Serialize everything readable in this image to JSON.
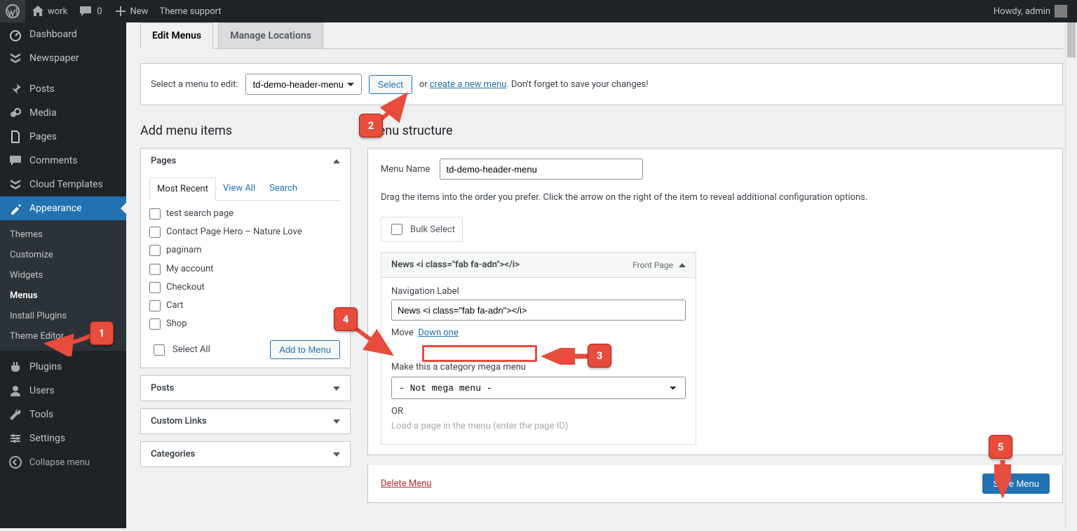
{
  "adminbar": {
    "site_name": "work",
    "comments_count": "0",
    "new_label": "New",
    "theme_support": "Theme support",
    "howdy": "Howdy, admin"
  },
  "sidebar": {
    "items": [
      {
        "label": "Dashboard",
        "icon": "dashboard"
      },
      {
        "label": "Newspaper",
        "icon": "newspaper"
      },
      {
        "label": "Posts",
        "icon": "pin"
      },
      {
        "label": "Media",
        "icon": "media"
      },
      {
        "label": "Pages",
        "icon": "pages"
      },
      {
        "label": "Comments",
        "icon": "comments"
      },
      {
        "label": "Cloud Templates",
        "icon": "cloud"
      },
      {
        "label": "Appearance",
        "icon": "appearance",
        "current": true
      },
      {
        "label": "Plugins",
        "icon": "plugins"
      },
      {
        "label": "Users",
        "icon": "users"
      },
      {
        "label": "Tools",
        "icon": "tools"
      },
      {
        "label": "Settings",
        "icon": "settings"
      }
    ],
    "appearance_sub": [
      {
        "label": "Themes"
      },
      {
        "label": "Customize"
      },
      {
        "label": "Widgets"
      },
      {
        "label": "Menus",
        "current": true
      },
      {
        "label": "Install Plugins"
      },
      {
        "label": "Theme Editor"
      }
    ],
    "collapse": "Collapse menu"
  },
  "tabs": {
    "edit": "Edit Menus",
    "locations": "Manage Locations"
  },
  "manage": {
    "prompt": "Select a menu to edit:",
    "selected_menu": "td-demo-header-menu",
    "select_btn": "Select",
    "or": "or",
    "create_link": "create a new menu",
    "after": ". Don't forget to save your changes!"
  },
  "left": {
    "heading": "Add menu items",
    "box_pages": "Pages",
    "tabs": {
      "recent": "Most Recent",
      "viewall": "View All",
      "search": "Search"
    },
    "pages_list": [
      "test search page",
      "Contact Page Hero – Nature Love",
      "paginam",
      "My account",
      "Checkout",
      "Cart",
      "Shop"
    ],
    "select_all": "Select All",
    "add_btn": "Add to Menu",
    "box_posts": "Posts",
    "box_links": "Custom Links",
    "box_cats": "Categories"
  },
  "right": {
    "heading": "Menu structure",
    "menu_name_label": "Menu Name",
    "menu_name_value": "td-demo-header-menu",
    "instructions": "Drag the items into the order you prefer. Click the arrow on the right of the item to reveal additional configuration options.",
    "bulk": "Bulk Select",
    "item": {
      "title": "News <i class=\"fab fa-adn\"></i>",
      "type": "Front Page",
      "nav_label_label": "Navigation Label",
      "nav_label_value": "News <i class=\"fab fa-adn\"></i>",
      "move_label": "Move",
      "move_down": "Down one",
      "mega_label": "Make this a category mega menu",
      "mega_value": "- Not mega menu -",
      "or": "OR",
      "load_page": "Load a page in the menu (enter the page ID)"
    },
    "delete": "Delete Menu",
    "save": "Save Menu"
  },
  "annotations": {
    "b1": "1",
    "b2": "2",
    "b3": "3",
    "b4": "4",
    "b5": "5"
  }
}
